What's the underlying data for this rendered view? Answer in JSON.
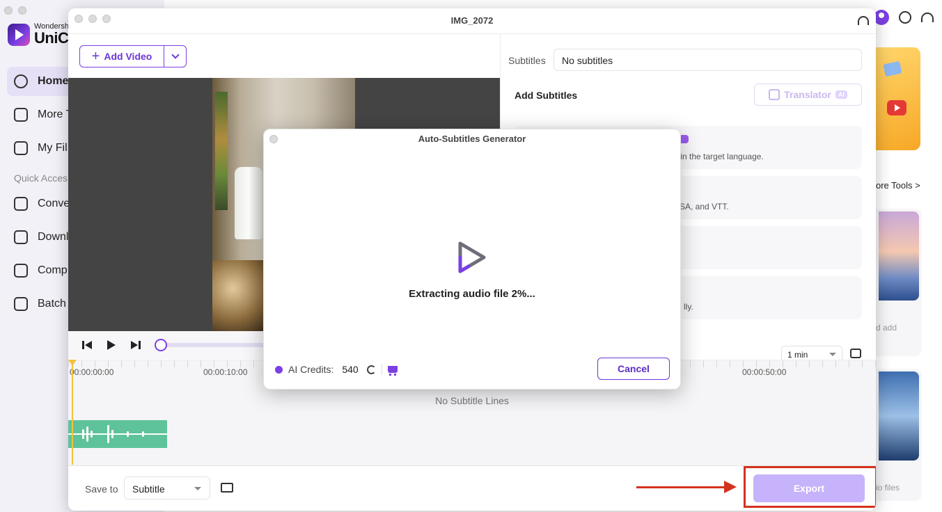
{
  "app": {
    "brand_small": "Wondersh",
    "brand_big": "UniCo",
    "nav": [
      {
        "label": "Home",
        "icon": "home-icon",
        "active": true
      },
      {
        "label": "More T",
        "icon": "toolbox-icon"
      },
      {
        "label": "My Fil",
        "icon": "file-icon"
      }
    ],
    "quick_access_label": "Quick Acces",
    "quick_nav": [
      {
        "label": "Conve",
        "icon": "convert-icon"
      },
      {
        "label": "Downl",
        "icon": "download-icon"
      },
      {
        "label": "Comp",
        "icon": "compress-icon"
      },
      {
        "label": "Batch",
        "icon": "batch-image-icon"
      }
    ],
    "more_tools_link": "ore Tools >",
    "tool_card_1_text": "d add",
    "tool_card_2_text": "io files"
  },
  "editor": {
    "title": "IMG_2072",
    "add_video_label": "Add Video",
    "subtitles_label": "Subtitles",
    "subtitles_value": "No subtitles",
    "add_subtitles_title": "Add Subtitles",
    "translator_label": "Translator",
    "ai_badge": "AI",
    "options": [
      {
        "desc": "s in the target language."
      },
      {
        "desc": "SA, and VTT."
      },
      {
        "desc": ""
      },
      {
        "desc": "lly."
      }
    ],
    "duration_value": "1 min",
    "timeline": {
      "ticks": [
        "00:00:00:00",
        "00:00:10:00",
        "00:00:50:00"
      ],
      "empty_text": "No Subtitle Lines"
    },
    "footer": {
      "save_to_label": "Save to",
      "save_to_value": "Subtitle",
      "export_label": "Export"
    }
  },
  "modal": {
    "title": "Auto-Subtitles Generator",
    "status": "Extracting audio file 2%...",
    "progress_percent": 2,
    "credits_label": "AI Credits:",
    "credits_value": "540",
    "cancel_label": "Cancel"
  },
  "colors": {
    "accent": "#7b3fe4",
    "export_disabled": "#c7b3fb",
    "annotation_red": "#d3321e",
    "audio_track": "#5ec39a",
    "playhead": "#f2c23b"
  }
}
